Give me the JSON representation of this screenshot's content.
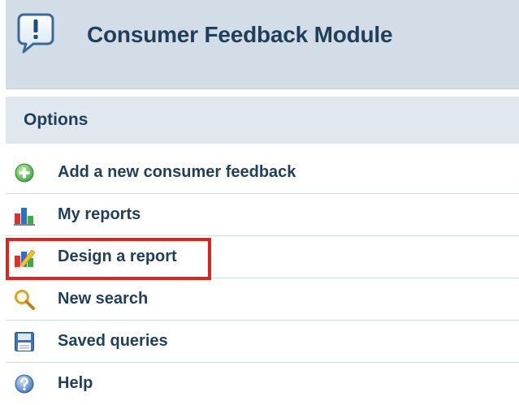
{
  "header": {
    "title": "Consumer Feedback Module",
    "icon": "speech-bubble-exclamation-icon"
  },
  "options": {
    "label": "Options"
  },
  "menu": {
    "items": [
      {
        "label": "Add a new consumer feedback",
        "icon": "add-circle-icon"
      },
      {
        "label": "My reports",
        "icon": "bar-chart-icon"
      },
      {
        "label": "Design a report",
        "icon": "chart-pencil-icon",
        "highlighted": true
      },
      {
        "label": "New search",
        "icon": "magnifier-icon"
      },
      {
        "label": "Saved queries",
        "icon": "floppy-disk-icon"
      },
      {
        "label": "Help",
        "icon": "help-circle-icon"
      }
    ]
  },
  "colors": {
    "header_background": "#d3dde7",
    "options_background": "#dfe7ef",
    "text": "#1f3f5a",
    "highlight_border": "#e2231a"
  }
}
